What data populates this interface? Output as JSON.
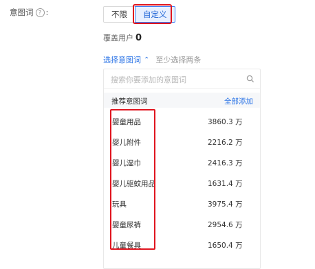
{
  "field": {
    "label": "意图词",
    "help_icon": "question-circle-icon",
    "colon": ":"
  },
  "mode_options": [
    "不限",
    "自定义"
  ],
  "selected_mode": "自定义",
  "coverage": {
    "label": "覆盖用户",
    "count": "0"
  },
  "select_toggle": {
    "label": "选择意图词",
    "hint": "至少选择两条",
    "expanded": true
  },
  "search": {
    "placeholder": "搜索你要添加的意图词"
  },
  "list": {
    "title": "推荐意图词",
    "add_all": "全部添加",
    "items": [
      {
        "name": "婴童用品",
        "value": "3860.3 万"
      },
      {
        "name": "婴儿附件",
        "value": "2216.2 万"
      },
      {
        "name": "婴儿湿巾",
        "value": "2416.3 万"
      },
      {
        "name": "婴儿驱蚊用品",
        "value": "1631.4 万"
      },
      {
        "name": "玩具",
        "value": "3975.4 万"
      },
      {
        "name": "婴童尿裤",
        "value": "2954.6 万"
      },
      {
        "name": "儿童餐具",
        "value": "1650.4 万"
      }
    ]
  },
  "colors": {
    "accent": "#2a73e6",
    "highlight": "#e0141e"
  }
}
